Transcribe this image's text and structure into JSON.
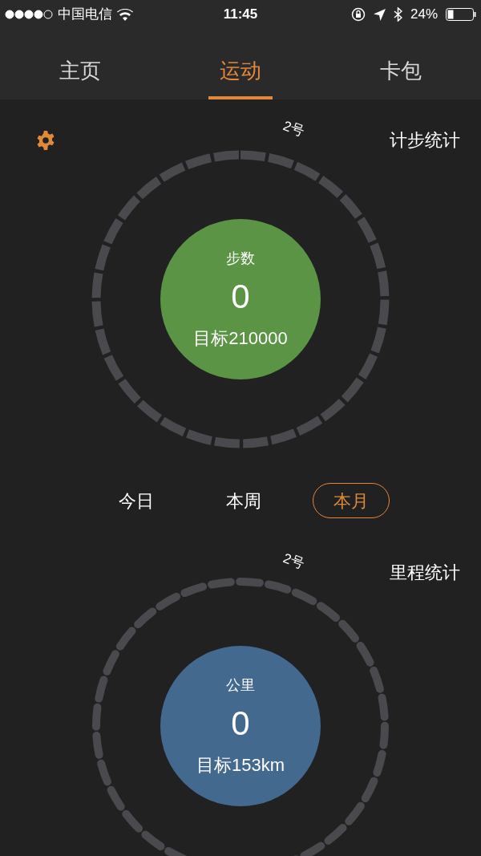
{
  "status_bar": {
    "carrier": "中国电信",
    "time": "11:45",
    "battery": "24%"
  },
  "tabs": [
    {
      "label": "主页",
      "selected": false
    },
    {
      "label": "运动",
      "selected": true
    },
    {
      "label": "卡包",
      "selected": false
    }
  ],
  "stats": [
    {
      "kind": "steps",
      "title": "计步统计",
      "day": "2号",
      "label": "步数",
      "value": "0",
      "goal": "目标210000",
      "color": "#5a9444"
    },
    {
      "kind": "distance",
      "title": "里程统计",
      "day": "2号",
      "label": "公里",
      "value": "0",
      "goal": "目标153km",
      "color": "#44698f"
    }
  ],
  "periods": [
    {
      "label": "今日",
      "selected": false
    },
    {
      "label": "本周",
      "selected": false
    },
    {
      "label": "本月",
      "selected": true
    }
  ]
}
